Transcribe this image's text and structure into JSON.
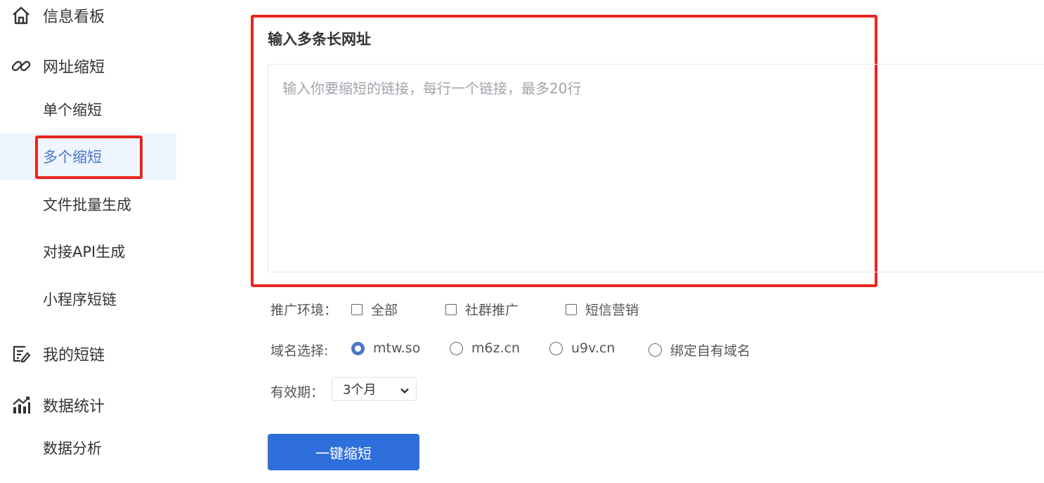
{
  "sidebar": {
    "dashboard": {
      "label": "信息看板",
      "icon": "home-icon"
    },
    "shorten": {
      "label": "网址缩短",
      "icon": "link-icon"
    },
    "sub_items": [
      "单个缩短",
      "多个缩短",
      "文件批量生成",
      "对接API生成",
      "小程序短链"
    ],
    "my_links": {
      "label": "我的短链",
      "icon": "list-edit-icon"
    },
    "stats": {
      "label": "数据统计",
      "icon": "chart-bar-icon"
    },
    "stats_sub": [
      "数据分析"
    ],
    "active_item": "多个缩短",
    "accent_color": "#4a76c9"
  },
  "main": {
    "title": "输入多条长网址",
    "textarea_placeholder": "输入你要缩短的链接，每行一个链接，最多20行",
    "textarea_value": "",
    "promo_env": {
      "label": "推广环境：",
      "options": [
        {
          "label": "全部",
          "checked": false
        },
        {
          "label": "社群推广",
          "checked": false
        },
        {
          "label": "短信营销",
          "checked": false
        }
      ]
    },
    "domain": {
      "label": "域名选择:",
      "options": [
        {
          "label": "mtw.so",
          "checked": true
        },
        {
          "label": "m6z.cn",
          "checked": false
        },
        {
          "label": "u9v.cn",
          "checked": false
        },
        {
          "label": "绑定自有域名",
          "checked": false
        }
      ]
    },
    "validity": {
      "label": "有效期：",
      "selected": "3个月"
    },
    "submit_label": "一键缩短",
    "button_color": "#2f6fdb",
    "highlight_color": "#e8251f"
  }
}
